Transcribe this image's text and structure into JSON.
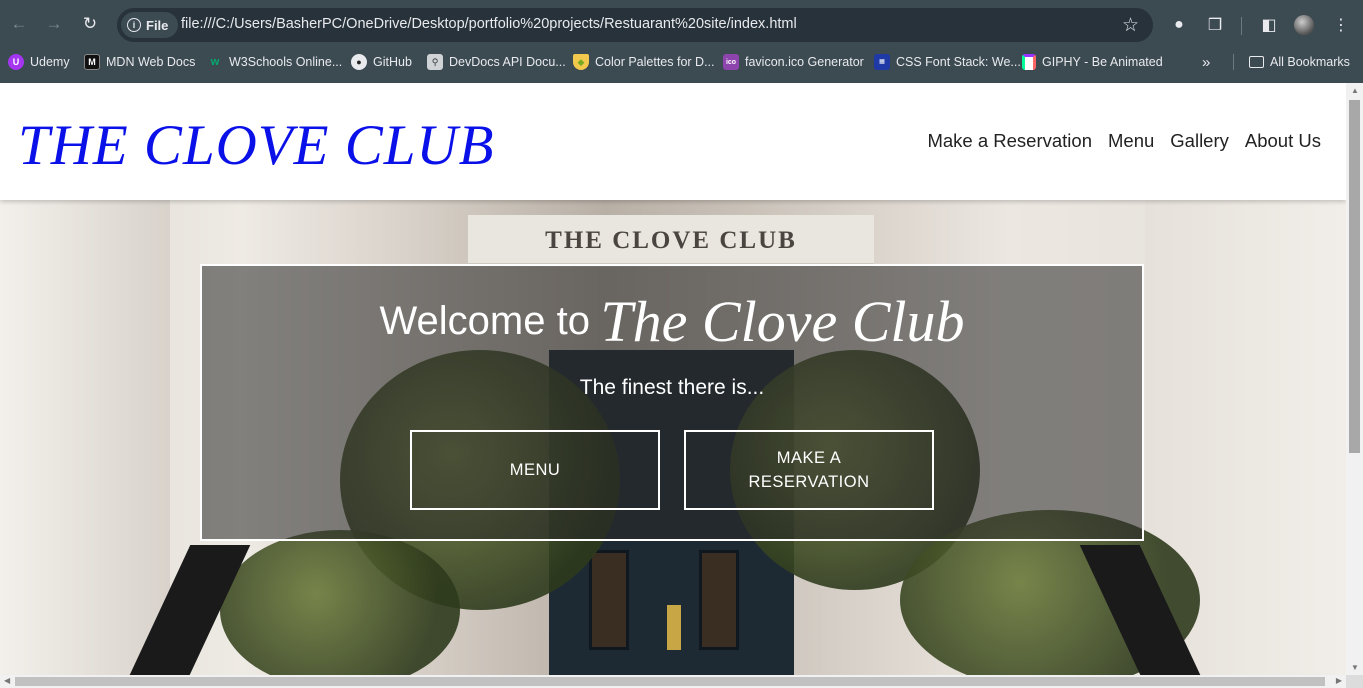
{
  "browser": {
    "site_chip": "File",
    "url": "file:///C:/Users/BasherPC/OneDrive/Desktop/portfolio%20projects/Restuarant%20site/index.html",
    "bookmarks": [
      {
        "label": "Udemy",
        "icon": "udemy-icon",
        "color": "#a435f0"
      },
      {
        "label": "MDN Web Docs",
        "icon": "mdn-icon",
        "color": "#111111"
      },
      {
        "label": "W3Schools Online...",
        "icon": "w3schools-icon",
        "color": "#04aa6d"
      },
      {
        "label": "GitHub",
        "icon": "github-icon",
        "color": "#e8eaed"
      },
      {
        "label": "DevDocs API Docu...",
        "icon": "devdocs-icon",
        "color": "#cfd3d6"
      },
      {
        "label": "Color Palettes for D...",
        "icon": "palette-icon",
        "color": "#f2c94c"
      },
      {
        "label": "favicon.ico Generator",
        "icon": "favicon-icon",
        "color": "#8e44ad"
      },
      {
        "label": "CSS Font Stack: We...",
        "icon": "cssfont-icon",
        "color": "#1f3aa6"
      },
      {
        "label": "GIPHY - Be Animated",
        "icon": "giphy-icon",
        "color": "#00ccff"
      }
    ],
    "all_bookmarks": "All Bookmarks"
  },
  "site": {
    "logo": "THE CLOVE CLUB",
    "nav": [
      "Make a Reservation",
      "Menu",
      "Gallery",
      "About Us"
    ],
    "brand_color": "#0a10e8"
  },
  "hero": {
    "lintel": "THE CLOVE CLUB",
    "welcome_prefix": "Welcome to",
    "welcome_name": "The Clove Club",
    "tagline": "The finest there is...",
    "buttons": [
      "MENU",
      "MAKE A RESERVATION"
    ]
  }
}
